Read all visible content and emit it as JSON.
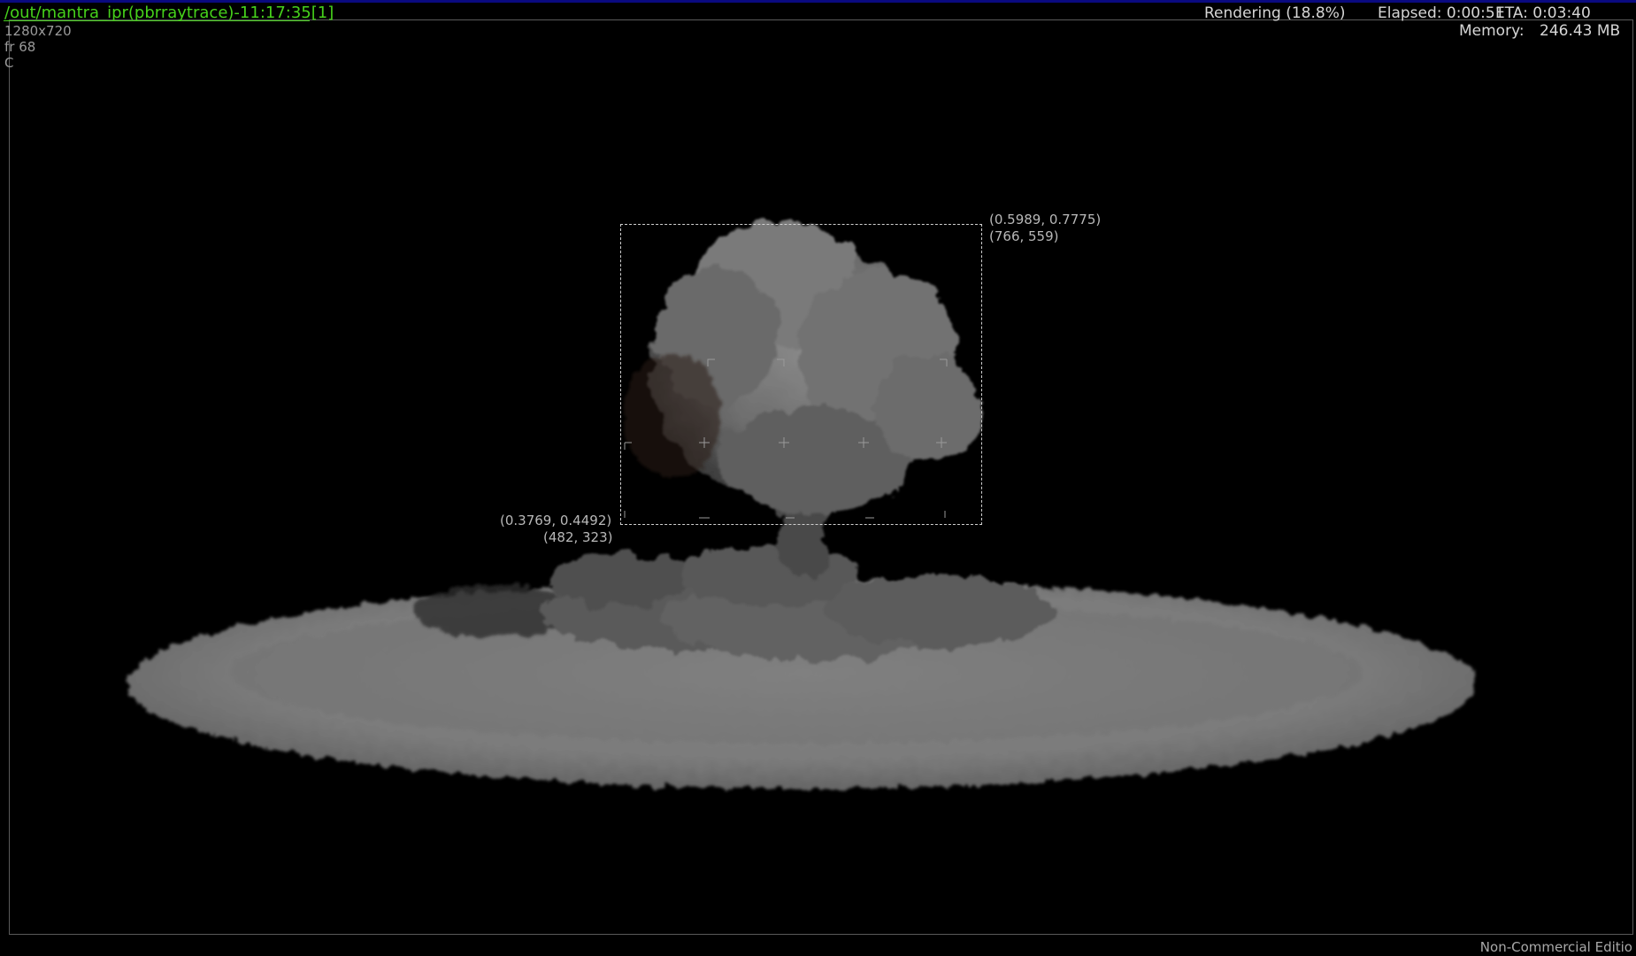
{
  "render": {
    "title": "/out/mantra_ipr(pbrraytrace)-11:17:35[1]",
    "resolution": "1280x720",
    "frame": "fr 68",
    "channel": "C",
    "status": "Rendering (18.8%)",
    "elapsed": "Elapsed: 0:00:51",
    "eta": "ETA: 0:03:40",
    "memory_label": "Memory:",
    "memory_value": "246.43 MB",
    "progress_percent": 18.8
  },
  "region": {
    "upper_right_uv": "(0.5989, 0.7775)",
    "upper_right_px": "(766, 559)",
    "lower_left_uv": "(0.3769, 0.4492)",
    "lower_left_px": "(482, 323)"
  },
  "footer": {
    "license": "Non-Commercial Editio"
  },
  "colors": {
    "title": "#46d11b",
    "progress_track": "#0a0a80",
    "background": "#000000"
  }
}
